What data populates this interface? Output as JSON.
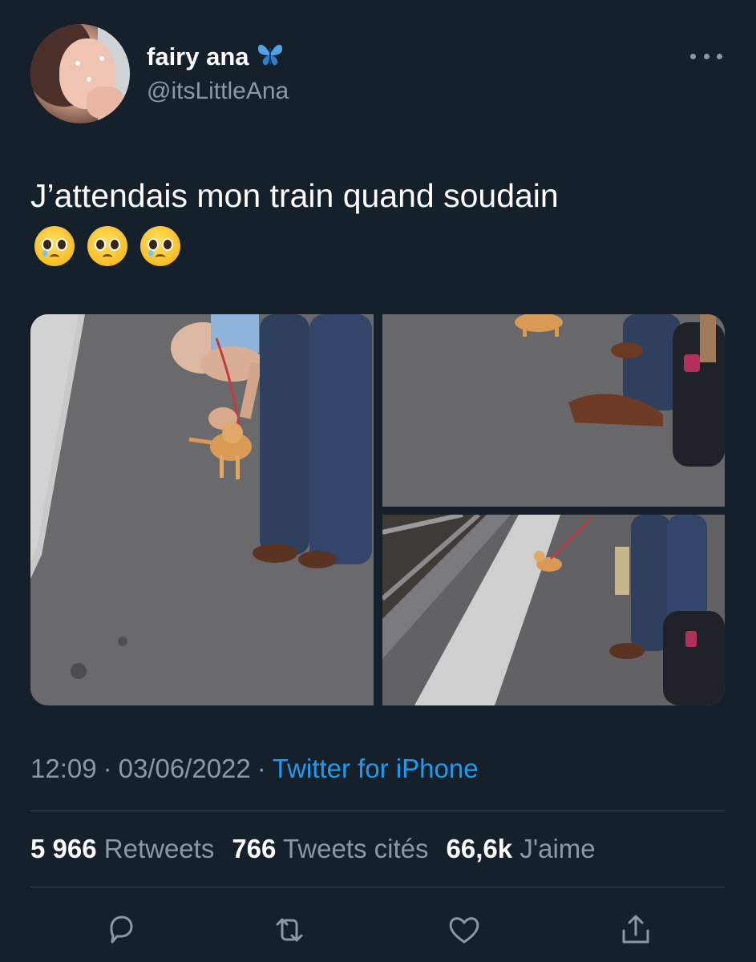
{
  "tweet": {
    "author": {
      "display_name": "fairy ana",
      "badge_icon": "butterfly-emoji-icon",
      "handle": "@itsLittleAna"
    },
    "text": "J’attendais mon train quand soudain",
    "emojis": [
      "pleading-face-with-tears-icon",
      "pleading-face-icon",
      "pleading-face-with-tears-icon"
    ],
    "media": {
      "count": 3
    },
    "time": "12:09",
    "separator": "·",
    "date": "03/06/2022",
    "source": "Twitter for iPhone",
    "stats": {
      "retweets_count": "5 966",
      "retweets_label": "Retweets",
      "quotes_count": "766",
      "quotes_label": "Tweets cités",
      "likes_count": "66,6k",
      "likes_label": "J'aime"
    }
  },
  "colors": {
    "background": "#15202b",
    "text_primary": "#ffffff",
    "text_secondary": "#8b98a5",
    "link": "#1d9bf0",
    "divider": "#38444d",
    "butterfly": "#4fa3e8"
  },
  "actions": [
    "reply-icon",
    "retweet-icon",
    "like-icon",
    "share-icon"
  ]
}
